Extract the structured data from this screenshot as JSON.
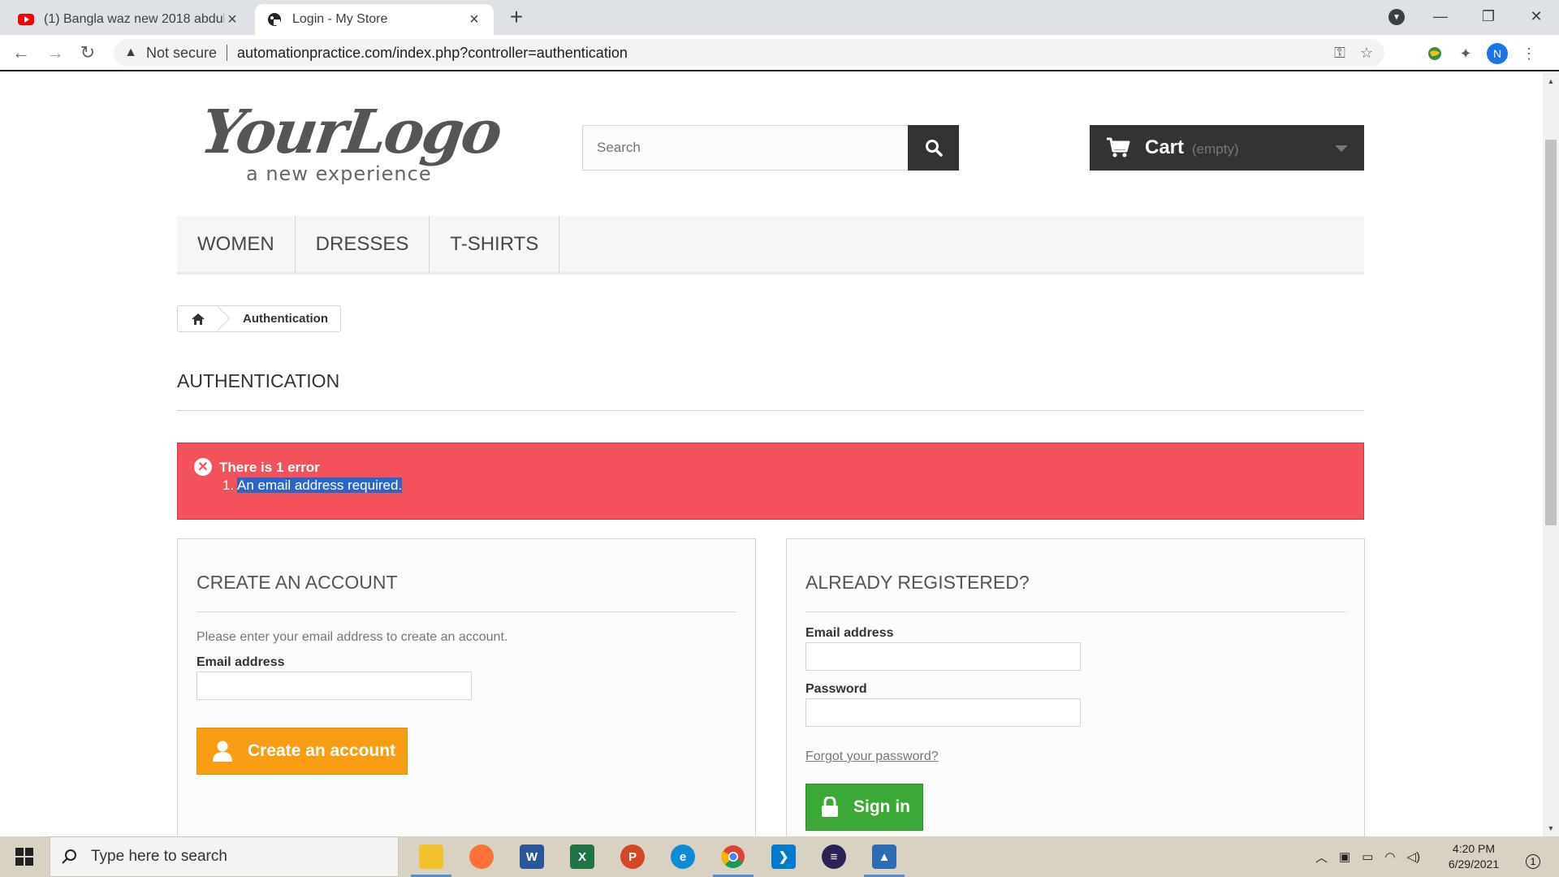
{
  "browser": {
    "tabs": [
      {
        "title": "(1) Bangla waz new 2018 abdullah",
        "active": false
      },
      {
        "title": "Login - My Store",
        "active": true
      }
    ],
    "close_glyph": "×",
    "new_tab_glyph": "+",
    "nav": {
      "back": "←",
      "forward": "→",
      "reload": "↻"
    },
    "security_label": "Not secure",
    "url": "automationpractice.com/index.php?controller=authentication",
    "profile_initial": "N",
    "window": {
      "minimize": "—",
      "maximize": "❐",
      "close": "✕"
    }
  },
  "store": {
    "logo": {
      "main": "YourLogo",
      "tagline": "a new experience"
    },
    "search": {
      "placeholder": "Search"
    },
    "cart": {
      "label": "Cart",
      "status": "(empty)"
    },
    "menu": [
      "WOMEN",
      "DRESSES",
      "T-SHIRTS"
    ],
    "breadcrumb": "Authentication",
    "page_heading": "AUTHENTICATION",
    "error": {
      "heading": "There is 1 error",
      "number": "1.",
      "message": "An email address required."
    },
    "create_account": {
      "heading": "CREATE AN ACCOUNT",
      "description": "Please enter your email address to create an account.",
      "email_label": "Email address",
      "email_value": "",
      "button": "Create an account"
    },
    "login": {
      "heading": "ALREADY REGISTERED?",
      "email_label": "Email address",
      "email_value": "",
      "password_label": "Password",
      "password_value": "",
      "forgot": "Forgot your password?",
      "button": "Sign in"
    }
  },
  "taskbar": {
    "search_placeholder": "Type here to search",
    "time": "4:20 PM",
    "date": "6/29/2021",
    "notification_count": "1"
  },
  "colors": {
    "error_bg": "#f3515c",
    "orange_button": "#f89d13",
    "green_button": "#3aa935",
    "dark": "#333333"
  }
}
